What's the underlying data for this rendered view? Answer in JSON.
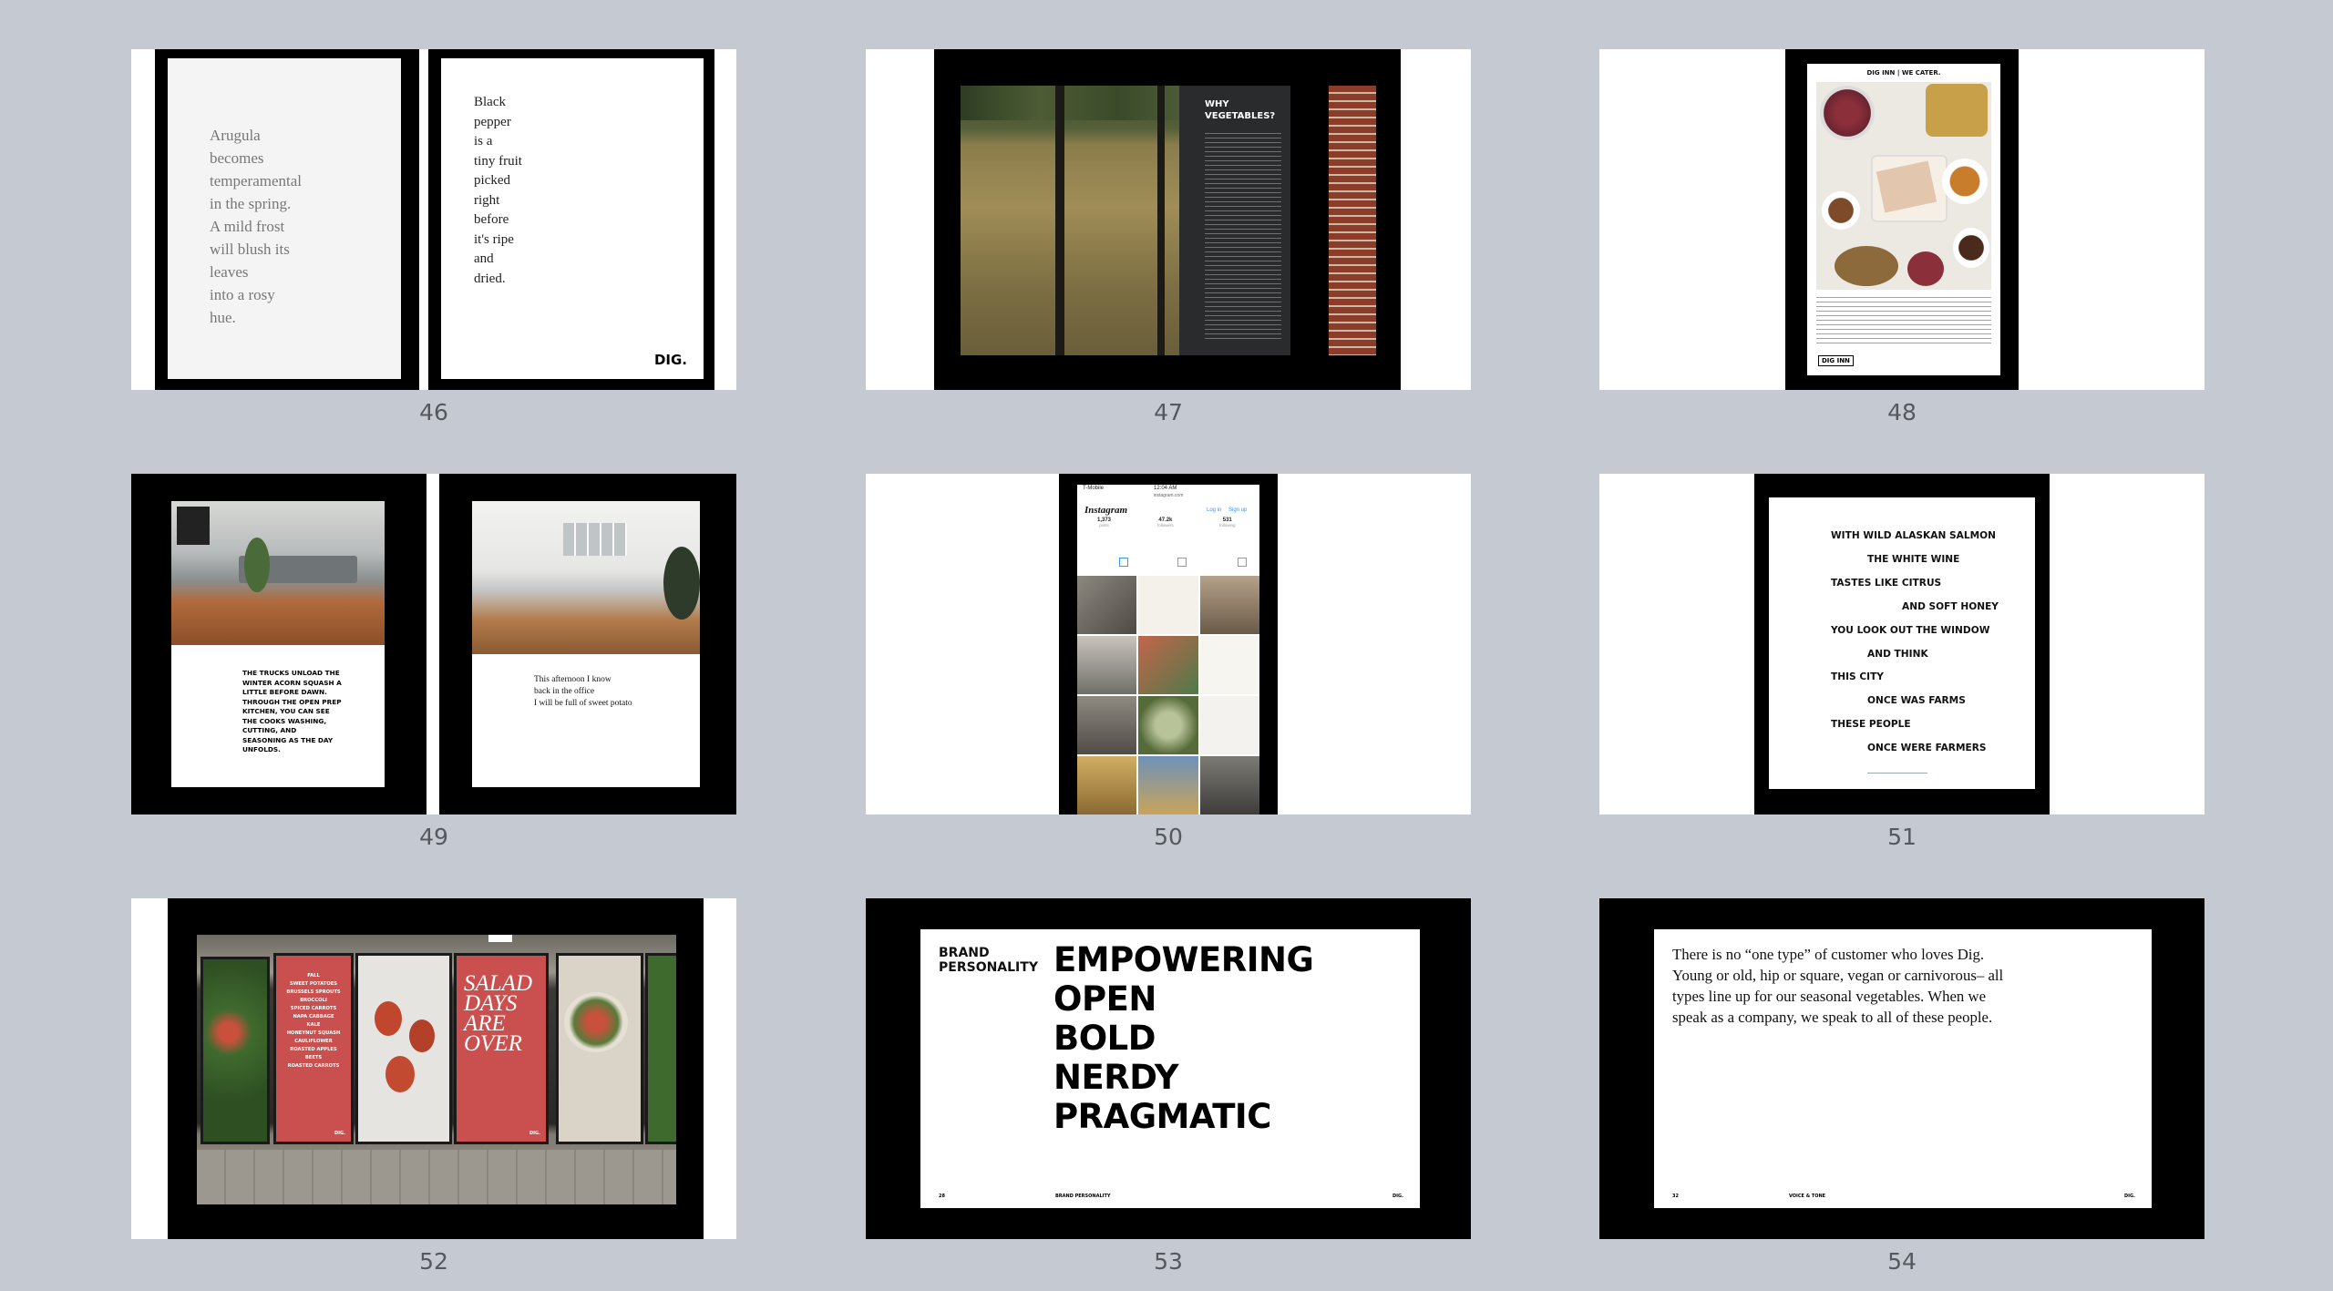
{
  "pages": {
    "p46": "46",
    "p47": "47",
    "p48": "48",
    "p49": "49",
    "p50": "50",
    "p51": "51",
    "p52": "52",
    "p53": "53",
    "p54": "54"
  },
  "s46": {
    "left_lines": [
      "Arugula",
      "becomes",
      "temperamental",
      "in the spring.",
      "A mild frost",
      "will blush its",
      "leaves",
      "into a rosy",
      "hue."
    ],
    "right_lines": [
      "Black",
      "pepper",
      "is a",
      "tiny fruit",
      "picked",
      "right",
      "before",
      "it's ripe",
      "and",
      "dried."
    ],
    "logo": "DIG."
  },
  "s47": {
    "title": "WHY VEGETABLES?"
  },
  "s48": {
    "header": "DIG INN | WE CATER.",
    "logo": "DIG INN"
  },
  "s49": {
    "left_text": "THE TRUCKS UNLOAD THE WINTER ACORN SQUASH A LITTLE BEFORE DAWN. THROUGH THE OPEN PREP KITCHEN, YOU CAN SEE THE COOKS WASHING, CUTTING, AND SEASONING AS THE DAY UNFOLDS.",
    "right_lines": [
      "This afternoon I know",
      "back in the office",
      "I will be full of sweet potato"
    ]
  },
  "s50": {
    "carrier": "T-Mobile",
    "time": "12:04 AM",
    "url": "instagram.com",
    "app": "Instagram",
    "login": "Log in",
    "signup": "Sign up",
    "stats": [
      {
        "n": "1,373",
        "l": "posts"
      },
      {
        "n": "47.2k",
        "l": "followers"
      },
      {
        "n": "531",
        "l": "following"
      }
    ]
  },
  "s51": {
    "lines": [
      {
        "t": "WITH WILD ALASKAN SALMON",
        "indent": false
      },
      {
        "t": "THE WHITE WINE",
        "indent": true
      },
      {
        "t": "TASTES LIKE CITRUS",
        "indent": false
      },
      {
        "t": "AND SOFT HONEY",
        "indent": "far"
      },
      {
        "t": "YOU LOOK OUT THE WINDOW",
        "indent": false
      },
      {
        "t": "AND THINK",
        "indent": true
      },
      {
        "t": "THIS CITY",
        "indent": false
      },
      {
        "t": "ONCE WAS FARMS",
        "indent": true
      },
      {
        "t": "THESE PEOPLE",
        "indent": false
      },
      {
        "t": "ONCE WERE FARMERS",
        "indent": true
      }
    ]
  },
  "s52": {
    "menu_lines": [
      "FALL",
      "SWEET POTATOES",
      "BRUSSELS SPROUTS",
      "BROCCOLI",
      "SPICED CARROTS",
      "NAPA CABBAGE",
      "KALE",
      "HONEYNUT SQUASH",
      "CAULIFLOWER",
      "ROASTED APPLES",
      "BEETS",
      "ROASTED CARROTS"
    ],
    "poster_headline": [
      "SALAD",
      "DAYS",
      "ARE",
      "OVER"
    ],
    "logo": "DIG."
  },
  "s53": {
    "label": [
      "BRAND",
      "PERSONALITY"
    ],
    "words": [
      "EMPOWERING",
      "OPEN",
      "BOLD",
      "NERDY",
      "PRAGMATIC"
    ],
    "footer_left": "28",
    "footer_mid": "BRAND PERSONALITY",
    "footer_right": "DIG."
  },
  "s54": {
    "paragraph": "There is no “one type” of customer who loves Dig.  Young or old, hip or square, vegan or carnivorous– all types line up for our seasonal vegetables. When we speak as a company, we speak to all of these people.",
    "footer_left": "32",
    "footer_mid": "VOICE & TONE",
    "footer_right": "DIG."
  },
  "colors": {
    "background": "#c5cad2",
    "poster_red": "#c9504f",
    "black": "#000000"
  }
}
